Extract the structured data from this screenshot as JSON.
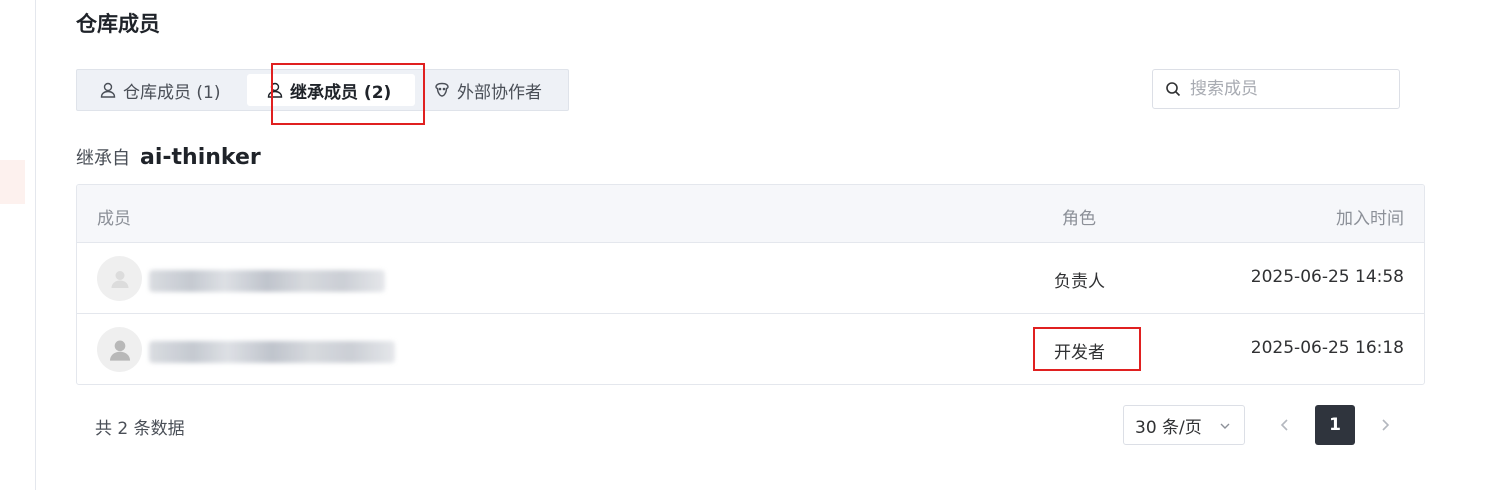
{
  "page": {
    "title": "仓库成员"
  },
  "tabs": [
    {
      "label": "仓库成员 (1)",
      "icon": "user-icon",
      "active": false
    },
    {
      "label": "继承成员 (2)",
      "icon": "user-icon",
      "active": true
    },
    {
      "label": "外部协作者",
      "icon": "collaborator-icon",
      "active": false
    }
  ],
  "search": {
    "placeholder": "搜索成员",
    "value": "",
    "icon": "search-icon"
  },
  "inherit": {
    "label": "继承自",
    "name": "ai-thinker"
  },
  "table": {
    "columns": {
      "member": "成员",
      "role": "角色",
      "joined": "加入时间"
    },
    "rows": [
      {
        "role": "负责人",
        "joined": "2025-06-25 14:58"
      },
      {
        "role": "开发者",
        "joined": "2025-06-25 16:18"
      }
    ]
  },
  "pagination": {
    "total_text": "共 2 条数据",
    "page_size": "30 条/页",
    "current_page": "1"
  },
  "colors": {
    "highlight": "#e02020",
    "active_page_bg": "#2f343d"
  }
}
